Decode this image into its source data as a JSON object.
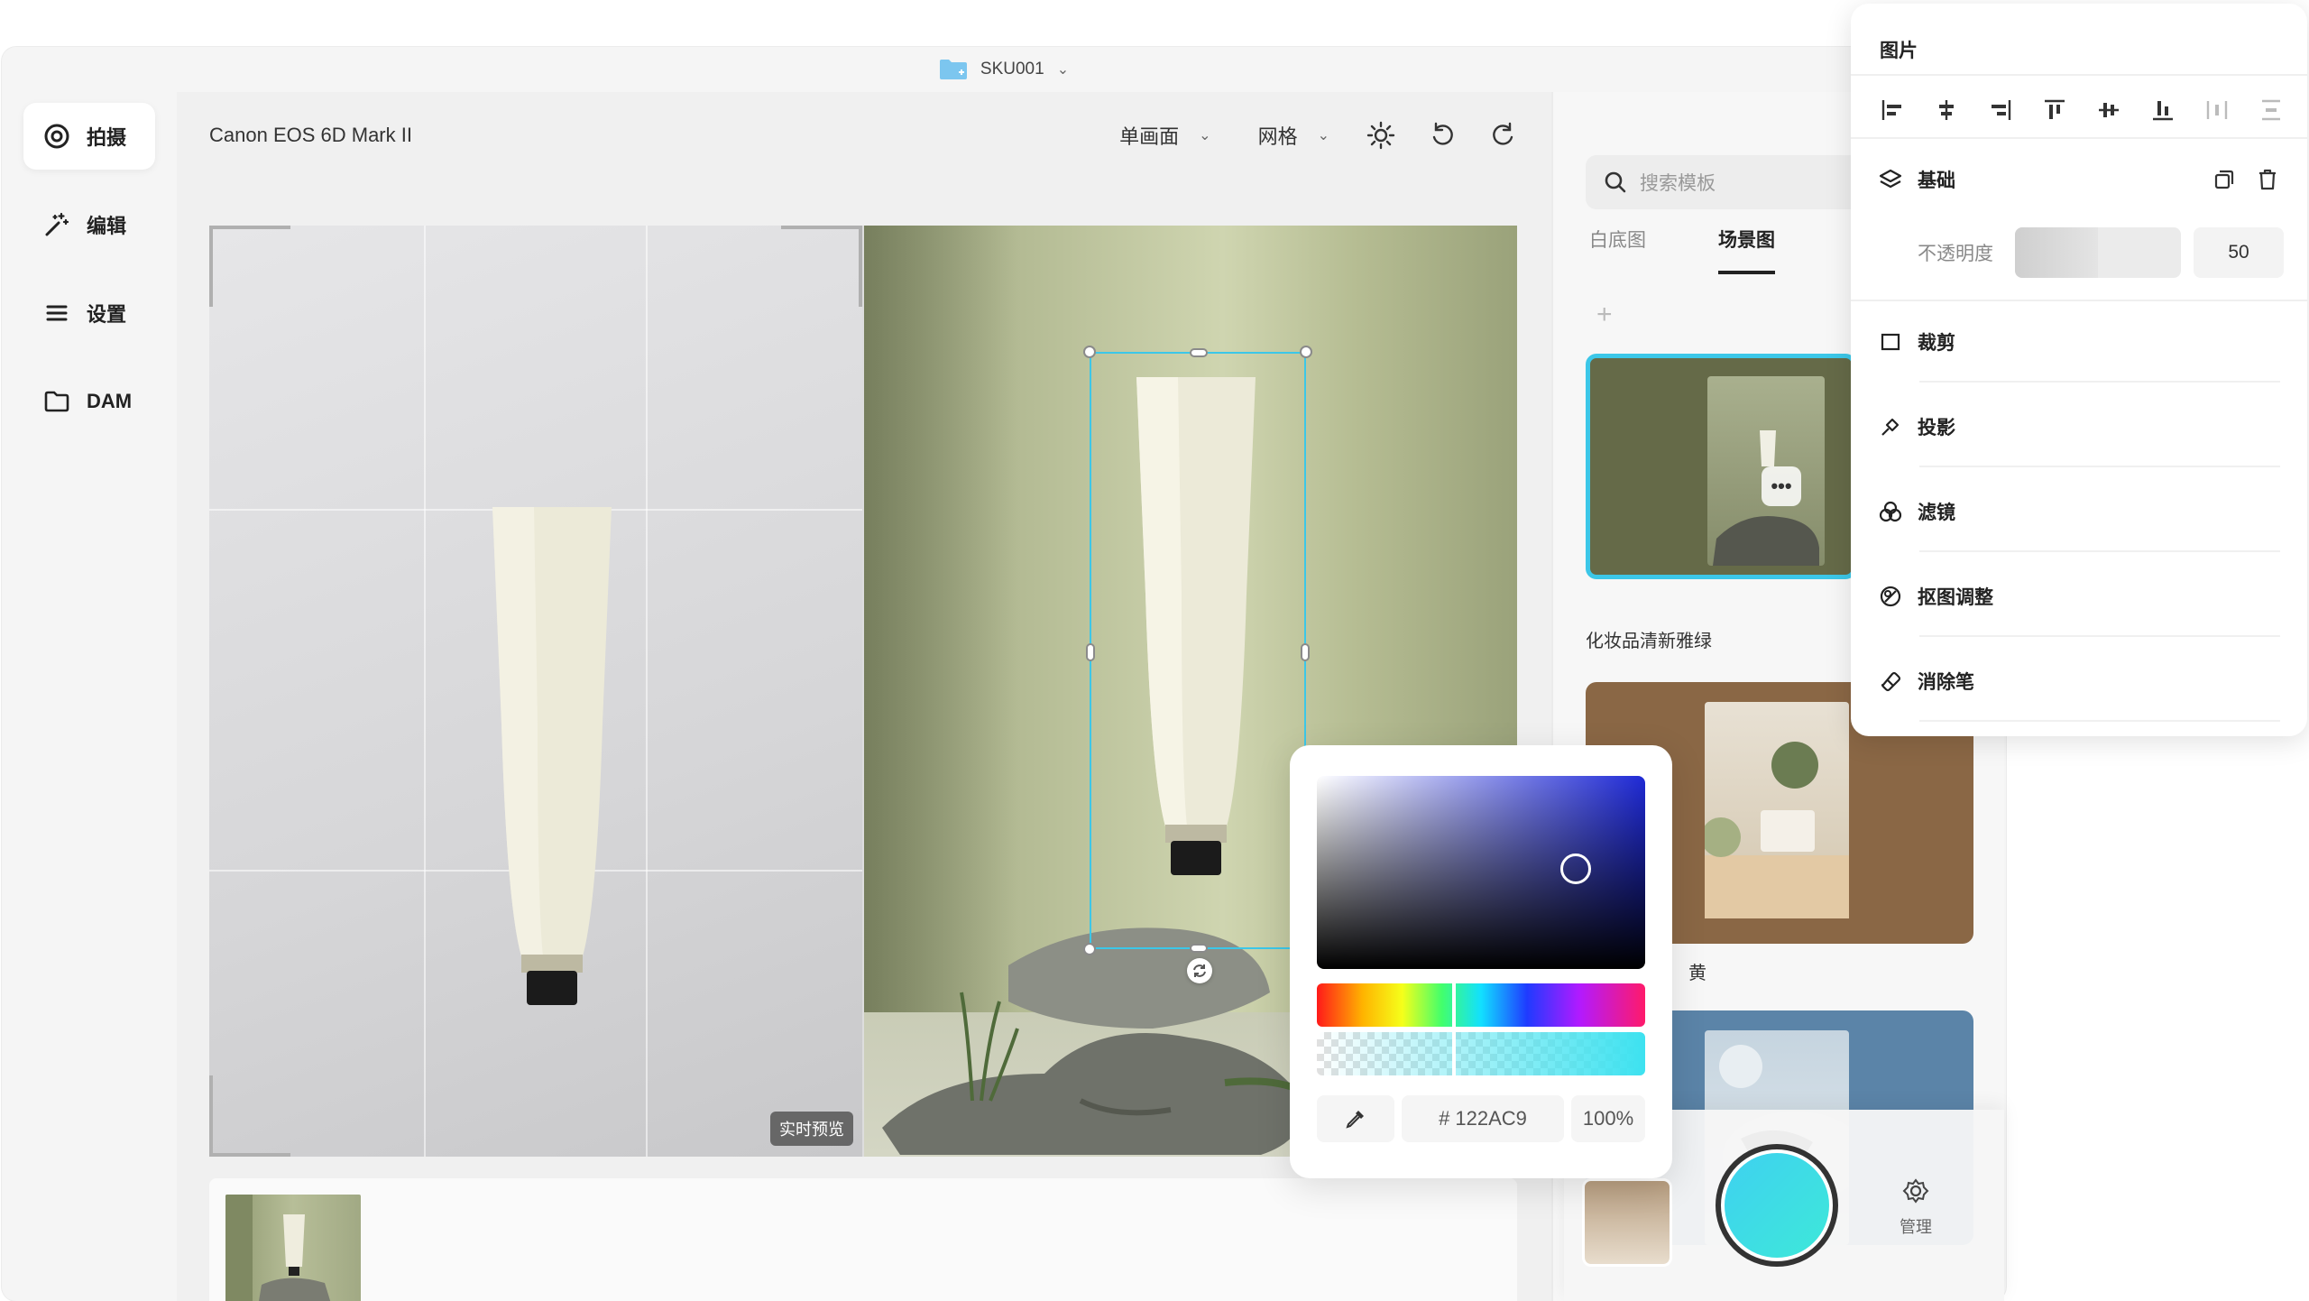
{
  "titlebar": {
    "project": "SKU001"
  },
  "nav": {
    "items": [
      {
        "label": "拍摄",
        "icon": "capture-icon",
        "active": true
      },
      {
        "label": "编辑",
        "icon": "magic-wand-icon",
        "active": false
      },
      {
        "label": "设置",
        "icon": "menu-icon",
        "active": false
      },
      {
        "label": "DAM",
        "icon": "folder-icon",
        "active": false
      }
    ]
  },
  "toolbar": {
    "camera": "Canon EOS 6D Mark II",
    "view_mode": "单画面",
    "grid": "网格"
  },
  "stage": {
    "live_preview": "实时预览"
  },
  "side": {
    "search_placeholder": "搜索模板",
    "tabs": [
      "白底图",
      "场景图"
    ],
    "active_tab": "场景图",
    "templates": [
      {
        "label": "化妆品清新雅绿",
        "selected": true,
        "menu": "•••"
      },
      {
        "label": "黄",
        "selected": false
      },
      {
        "label": "",
        "selected": false
      }
    ],
    "manage_label": "管理"
  },
  "picker": {
    "hex": "# 122AC9",
    "alpha": "100%",
    "colors": {
      "selected": "#122AC9",
      "shutter": "#3fd8ec"
    }
  },
  "props": {
    "title": "图片",
    "basic": {
      "label": "基础",
      "opacity_label": "不透明度",
      "opacity_value": "50"
    },
    "items": [
      "裁剪",
      "投影",
      "滤镜",
      "抠图调整",
      "消除笔"
    ]
  },
  "colors": {
    "accent": "#3cc7e8"
  }
}
